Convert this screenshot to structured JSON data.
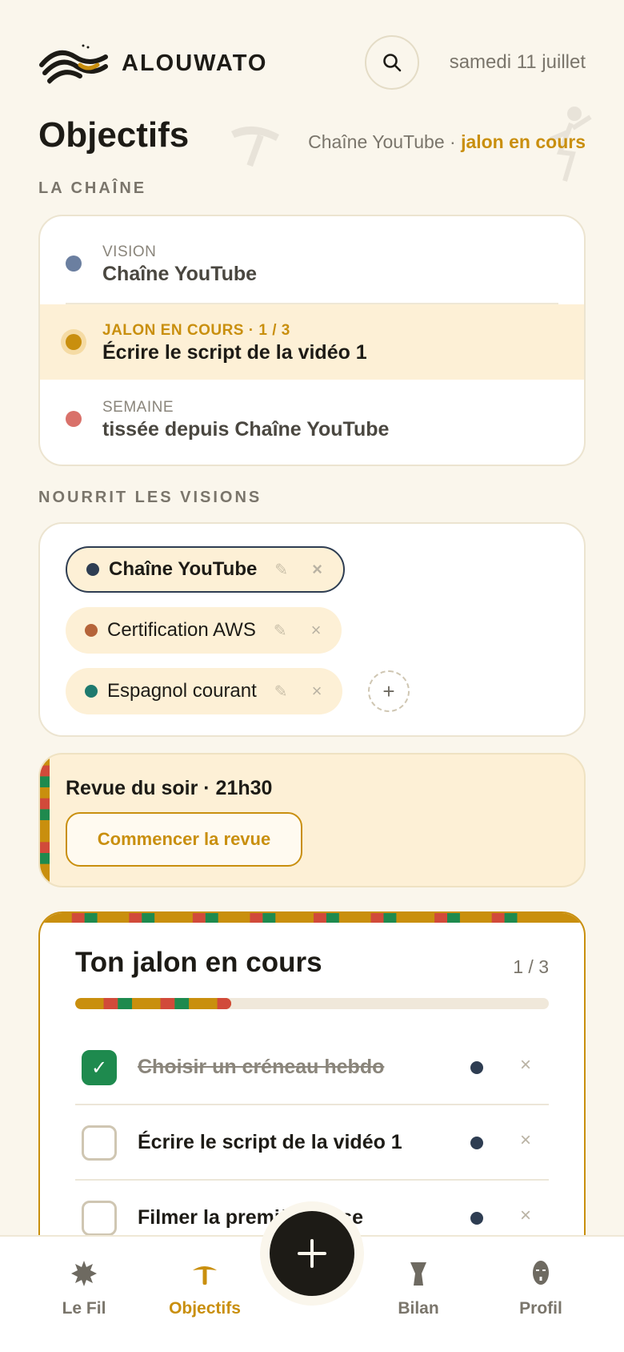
{
  "app": {
    "brand": "ALOUWATO",
    "date": "samedi 11 juillet"
  },
  "page": {
    "title": "Objectifs",
    "meta_prefix": "Chaîne YouTube ·",
    "meta_accent": "jalon en cours"
  },
  "chain_section": {
    "label": "LA CHAÎNE",
    "rows": [
      {
        "kicker": "VISION",
        "text": "Chaîne YouTube",
        "color": "#6b7fa0"
      },
      {
        "kicker": "JALON EN COURS · 1 / 3",
        "text": "Écrire le script de la vidéo 1",
        "color": "#c98f0e"
      },
      {
        "kicker": "SEMAINE",
        "text": "tissée depuis Chaîne YouTube",
        "color": "#d9716a"
      }
    ]
  },
  "visions_section": {
    "label": "NOURRIT LES VISIONS",
    "chips": [
      {
        "label": "Chaîne YouTube",
        "color": "#2e3d52",
        "selected": true
      },
      {
        "label": "Certification AWS",
        "color": "#b5643a",
        "selected": false
      },
      {
        "label": "Espagnol courant",
        "color": "#1e7a6e",
        "selected": false
      }
    ],
    "edit_icon": "✎",
    "remove_icon": "×",
    "add_icon": "+"
  },
  "review": {
    "title": "Revue du soir · 21h30",
    "button": "Commencer la revue"
  },
  "milestone": {
    "title": "Ton jalon en cours",
    "count": "1 / 3",
    "progress": 0.33,
    "tasks": [
      {
        "label": "Choisir un créneau hebdo",
        "done": true
      },
      {
        "label": "Écrire le script de la vidéo 1",
        "done": false
      },
      {
        "label": "Filmer la première prise",
        "done": false
      }
    ],
    "check_icon": "✓",
    "remove_icon": "×"
  },
  "nav": {
    "items": [
      {
        "label": "Le Fil",
        "icon": "sun-burst-icon"
      },
      {
        "label": "Objectifs",
        "icon": "mushroom-icon",
        "active": true
      },
      {
        "label": "Bilan",
        "icon": "drum-icon"
      },
      {
        "label": "Profil",
        "icon": "mask-icon"
      }
    ],
    "fab_icon": "plus-icon"
  },
  "colors": {
    "accent": "#c98f0e",
    "background": "#faf6ec",
    "ink": "#1d1b16",
    "kente_red": "#d14a3a",
    "kente_green": "#1e8a4e"
  }
}
